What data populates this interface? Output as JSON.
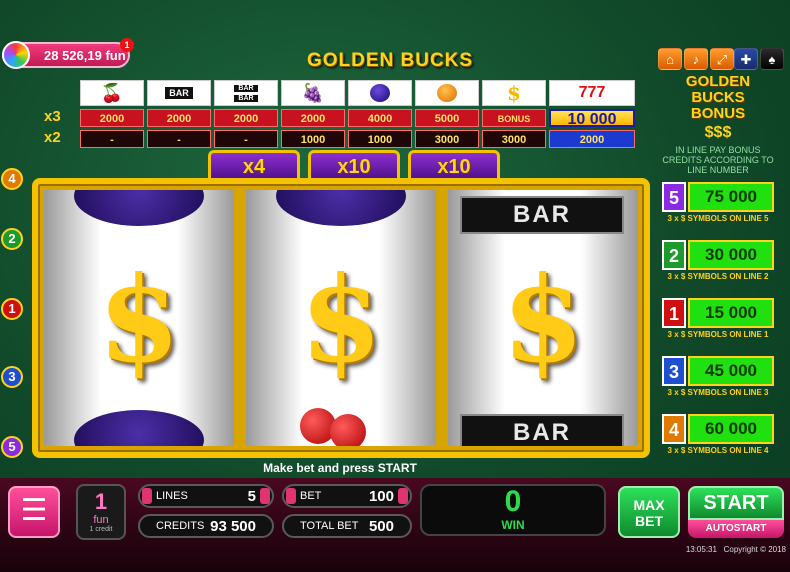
{
  "balance": {
    "value": "28 526,19 fun",
    "badge": "1"
  },
  "title": "GOLDEN BUCKS",
  "top_icons": [
    "home-icon",
    "sound-icon",
    "fullscreen-icon",
    "uk-flag-icon",
    "settings-icon"
  ],
  "paytable": {
    "row_labels": [
      "x3",
      "x2"
    ],
    "columns": [
      {
        "symbol": "cherry",
        "x3": "2000",
        "x2": "-"
      },
      {
        "symbol": "bar",
        "x3": "2000",
        "x2": "-"
      },
      {
        "symbol": "double-bar",
        "x3": "2000",
        "x2": "-"
      },
      {
        "symbol": "grapes",
        "x3": "2000",
        "x2": "1000"
      },
      {
        "symbol": "plum",
        "x3": "4000",
        "x2": "1000"
      },
      {
        "symbol": "orange",
        "x3": "5000",
        "x2": "3000"
      },
      {
        "symbol": "golden-bucks",
        "x3": "BONUS",
        "x2": "3000",
        "note": "GOLDEN BUCKS BONUS"
      },
      {
        "symbol": "seven",
        "x3": "10 000",
        "x2": "2000"
      }
    ],
    "bar_label": "BAR"
  },
  "multipliers": [
    "x4",
    "x10",
    "x10"
  ],
  "reels": [
    {
      "top": "plum",
      "middle": "$",
      "bottom": "plum"
    },
    {
      "top": "plum",
      "middle": "$",
      "bottom": "cherry"
    },
    {
      "top": "BAR",
      "middle": "$",
      "bottom": "BAR"
    }
  ],
  "line_markers": [
    "4",
    "2",
    "1",
    "3",
    "5"
  ],
  "bonus": {
    "title_lines": [
      "GOLDEN",
      "BUCKS",
      "BONUS"
    ],
    "dollars": "$$$",
    "description": "IN LINE PAY BONUS CREDITS ACCORDING TO LINE NUMBER",
    "rows": [
      {
        "line": "5",
        "amount": "75 000",
        "label": "3 x $ SYMBOLS ON LINE 5",
        "color": "#8a2be2"
      },
      {
        "line": "2",
        "amount": "30 000",
        "label": "3 x $ SYMBOLS ON LINE 2",
        "color": "#1d9a2c"
      },
      {
        "line": "1",
        "amount": "15 000",
        "label": "3 x $ SYMBOLS ON LINE 1",
        "color": "#d01010"
      },
      {
        "line": "3",
        "amount": "45 000",
        "label": "3 x $ SYMBOLS ON LINE 3",
        "color": "#1d4fd0"
      },
      {
        "line": "4",
        "amount": "60 000",
        "label": "3 x $ SYMBOLS ON LINE 4",
        "color": "#e07a00"
      }
    ]
  },
  "prompt": "Make bet and press START",
  "controls": {
    "coin_value": "1",
    "coin_unit": "fun",
    "coin_sub": "1 credit",
    "lines_label": "LINES",
    "lines_value": "5",
    "bet_label": "BET",
    "bet_value": "100",
    "credits_label": "CREDITS",
    "credits_value": "93 500",
    "total_bet_label": "TOTAL BET",
    "total_bet_value": "500",
    "win_value": "0",
    "win_label": "WIN",
    "maxbet_label": "MAX BET",
    "start_label": "START",
    "autostart_label": "AUTOSTART"
  },
  "footer": {
    "time": "13:05:31",
    "copyright": "Copyright © 2018"
  }
}
